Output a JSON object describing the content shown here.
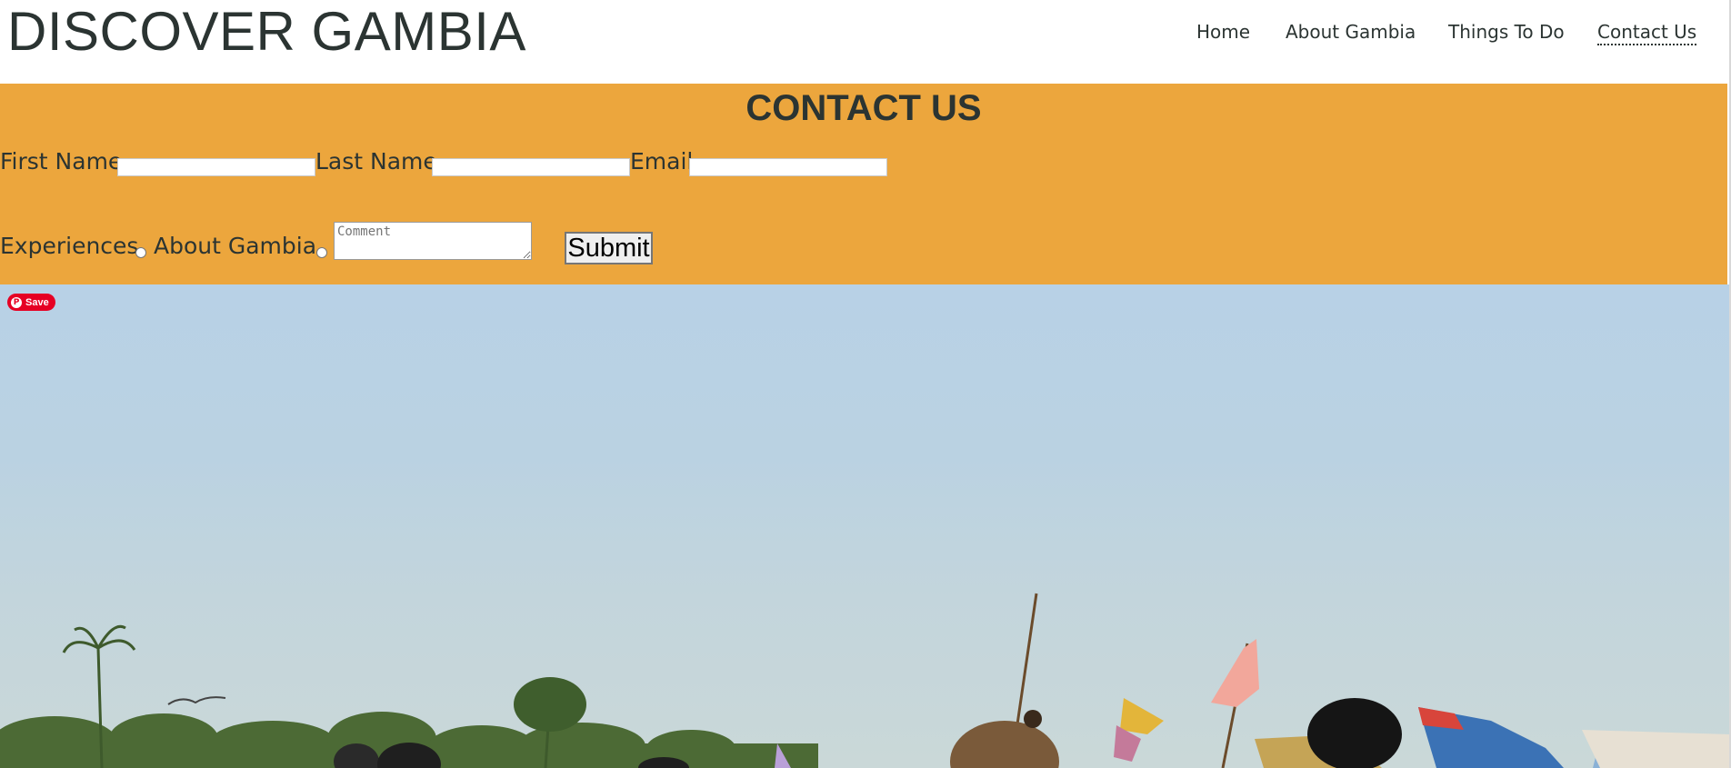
{
  "header": {
    "site_title": "DISCOVER GAMBIA",
    "nav": [
      {
        "label": "Home"
      },
      {
        "label": "About Gambia"
      },
      {
        "label": "Things To Do"
      },
      {
        "label": "Contact Us",
        "active": true
      }
    ]
  },
  "contact": {
    "heading": "CONTACT US",
    "first_name_label": "First Name",
    "first_name_value": "",
    "last_name_label": "Last Name",
    "last_name_value": "",
    "email_label": "Email",
    "email_value": "",
    "radio_experiences_label": "Experiences",
    "radio_about_label": "About Gambia",
    "comment_placeholder": "Comment",
    "submit_label": "Submit"
  },
  "hero": {
    "save_button_label": "Save",
    "save_button_icon": "pinterest-icon"
  },
  "colors": {
    "contact_band": "#eca63d",
    "text_dark": "#2b3432",
    "pinterest_red": "#e60023",
    "sky": "#b8d1e6"
  }
}
